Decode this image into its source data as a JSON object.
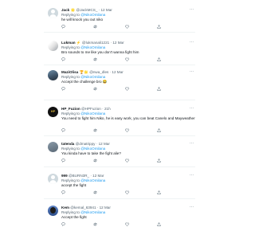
{
  "reply_prefix": "Replying to",
  "tweets": [
    {
      "name": "Jack",
      "badge": "🌟",
      "handle": "@JackMCS_",
      "date": "12 Mar",
      "mention": "@NikoOmilana",
      "text": "he will knock you out niko",
      "avatar": "default"
    },
    {
      "name": "Lukman",
      "badge": "⚡",
      "handle": "@lukmanali1221",
      "date": "12 Mar",
      "mention": "@NikoOmilana",
      "text": "Bro sounds to me like you don't wanna fight him",
      "avatar": "lukman"
    },
    {
      "name": "MaziOlisa",
      "badge": "🏆🌟",
      "handle": "@nwa_dles",
      "date": "12 Mar",
      "mention": "@NikoOmilana",
      "text": "Accept the challenge bro 😂",
      "avatar": "mazi"
    },
    {
      "name": "HP_Fuzion",
      "badge": "",
      "handle": "@HPFuzion",
      "date": "21h",
      "mention": "@NikoOmilana",
      "text": "You need to fight him Niko, he is easy work, you can beat Canelo and Mayweather",
      "avatar": "hp",
      "avatar_text": "HP"
    },
    {
      "name": "tatenda",
      "badge": "",
      "handle": "@dmatrippy",
      "date": "12 Mar",
      "mention": "@NikoOmilana",
      "text": "You kinda have to take the fight alie?",
      "avatar": "tatenda"
    },
    {
      "name": "999",
      "badge": "",
      "handle": "@BURN3R_",
      "date": "12 Mar",
      "mention": "@NikoOmilana",
      "text": "accept the fight",
      "avatar": "default"
    },
    {
      "name": "Kem",
      "badge": "",
      "handle": "@kemal_63941",
      "date": "12 Mar",
      "mention": "@NikoOmilana",
      "text": "Accept the fight",
      "avatar": "kem"
    }
  ],
  "icons": {
    "reply": "reply-icon",
    "retweet": "retweet-icon",
    "like": "heart-icon",
    "share": "share-icon",
    "more": "more-icon"
  },
  "colors": {
    "link": "#1d9bf0",
    "muted": "#536471",
    "text": "#0f1419"
  }
}
